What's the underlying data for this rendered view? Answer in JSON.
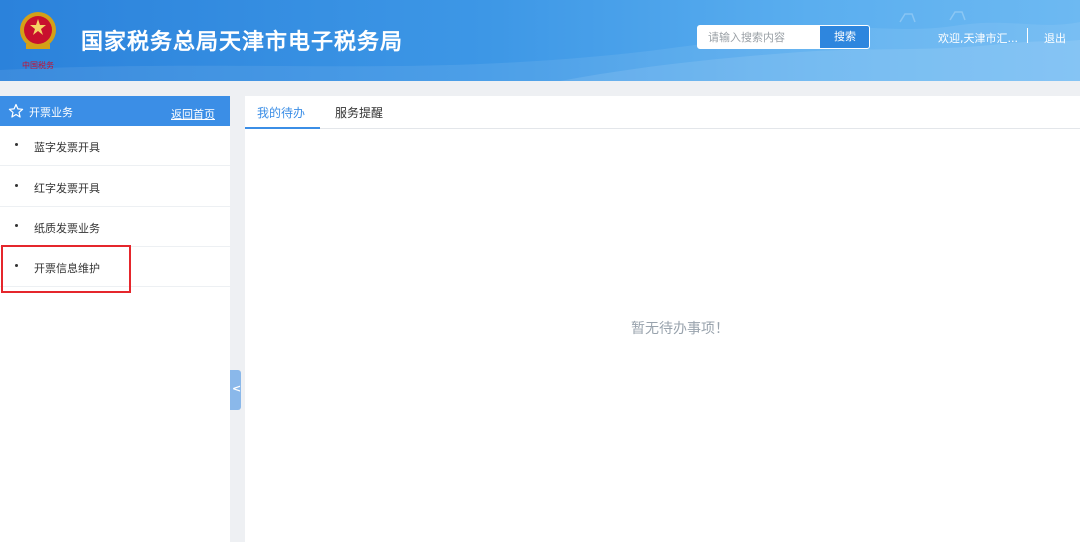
{
  "header": {
    "site_title": "国家税务总局天津市电子税务局",
    "search_placeholder": "请输入搜索内容",
    "search_button": "搜索",
    "welcome_text": "欢迎,天津市汇...",
    "logout_label": "退出",
    "logo_icon": "tax-emblem-icon",
    "colors": {
      "header_blue": "#2b82db",
      "accent": "#3b8ee6"
    }
  },
  "sidebar": {
    "title": "开票业务",
    "title_icon": "star-icon",
    "home_link": "返回首页",
    "items": [
      {
        "label": "蓝字发票开具"
      },
      {
        "label": "红字发票开具"
      },
      {
        "label": "纸质发票业务"
      },
      {
        "label": "开票信息维护",
        "highlighted": true
      }
    ],
    "collapse_glyph": "<"
  },
  "main": {
    "tabs": [
      {
        "label": "我的待办",
        "active": true
      },
      {
        "label": "服务提醒",
        "active": false
      }
    ],
    "empty_message": "暂无待办事项！"
  }
}
